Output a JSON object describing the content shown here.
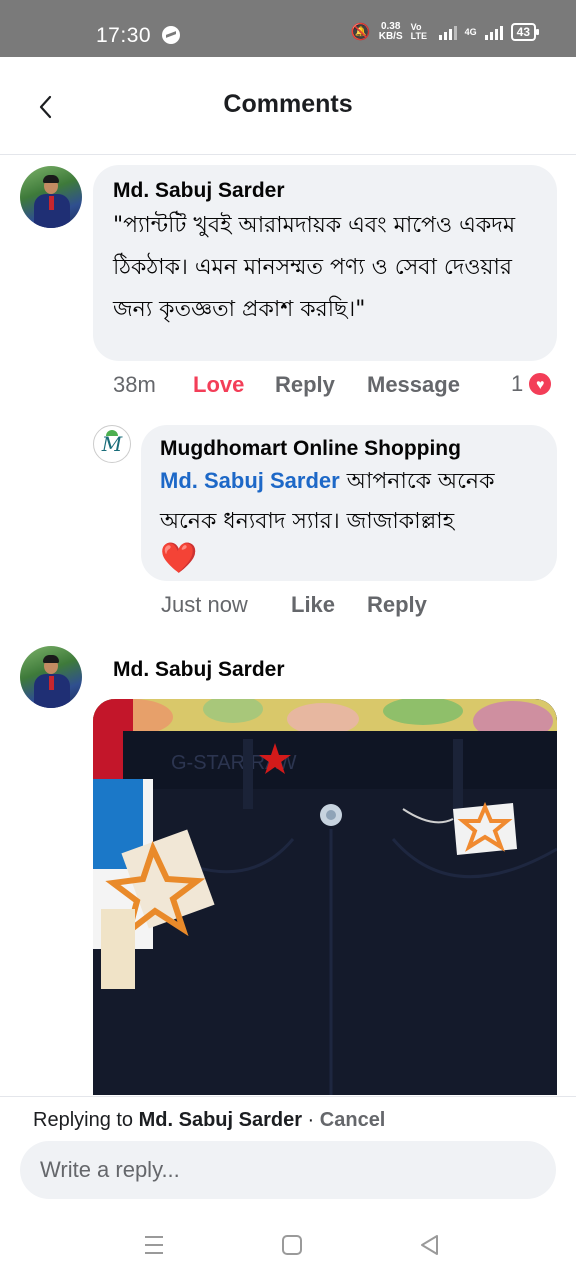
{
  "status_bar": {
    "time": "17:30",
    "net_speed_value": "0.38",
    "net_speed_unit": "KB/S",
    "volte": "Vo LTE",
    "network": "4G",
    "battery": "43"
  },
  "header": {
    "title": "Comments",
    "back_icon": "chevron-left-icon"
  },
  "comment1": {
    "author": "Md. Sabuj Sarder",
    "text": "\"প্যান্টটি খুবই আরামদায়ক এবং মাপেও একদম ঠিকঠাক। এমন মানসম্মত পণ্য ও সেবা দেওয়ার জন্য কৃতজ্ঞতা প্রকাশ করছি।\"",
    "time": "38m",
    "love_label": "Love",
    "reply_label": "Reply",
    "message_label": "Message",
    "reaction_count": "1"
  },
  "reply1": {
    "author": "Mugdhomart Online Shopping",
    "mention": "Md. Sabuj Sarder",
    "text": " আপনাকে অনেক অনেক ধন্যবাদ স্যার। জাজাকাল্লাহ",
    "emoji": "❤️",
    "avatar_letter": "M",
    "time": "Just now",
    "like_label": "Like",
    "reply_label": "Reply"
  },
  "comment2": {
    "author": "Md. Sabuj Sarder",
    "photo_alt": "Photo of black jeans with tags"
  },
  "reply_bar": {
    "replying_prefix": "Replying to",
    "replying_name": "Md. Sabuj Sarder",
    "separator": " · ",
    "cancel_label": "Cancel",
    "placeholder": "Write a reply..."
  },
  "nav": {
    "menu_icon": "menu-icon",
    "home_icon": "home-square-icon",
    "back_icon": "back-triangle-icon"
  },
  "colors": {
    "love": "#f33e58",
    "mention": "#1d68c7",
    "bubble": "#f0f2f5",
    "status_bar": "#7a7a7a"
  }
}
